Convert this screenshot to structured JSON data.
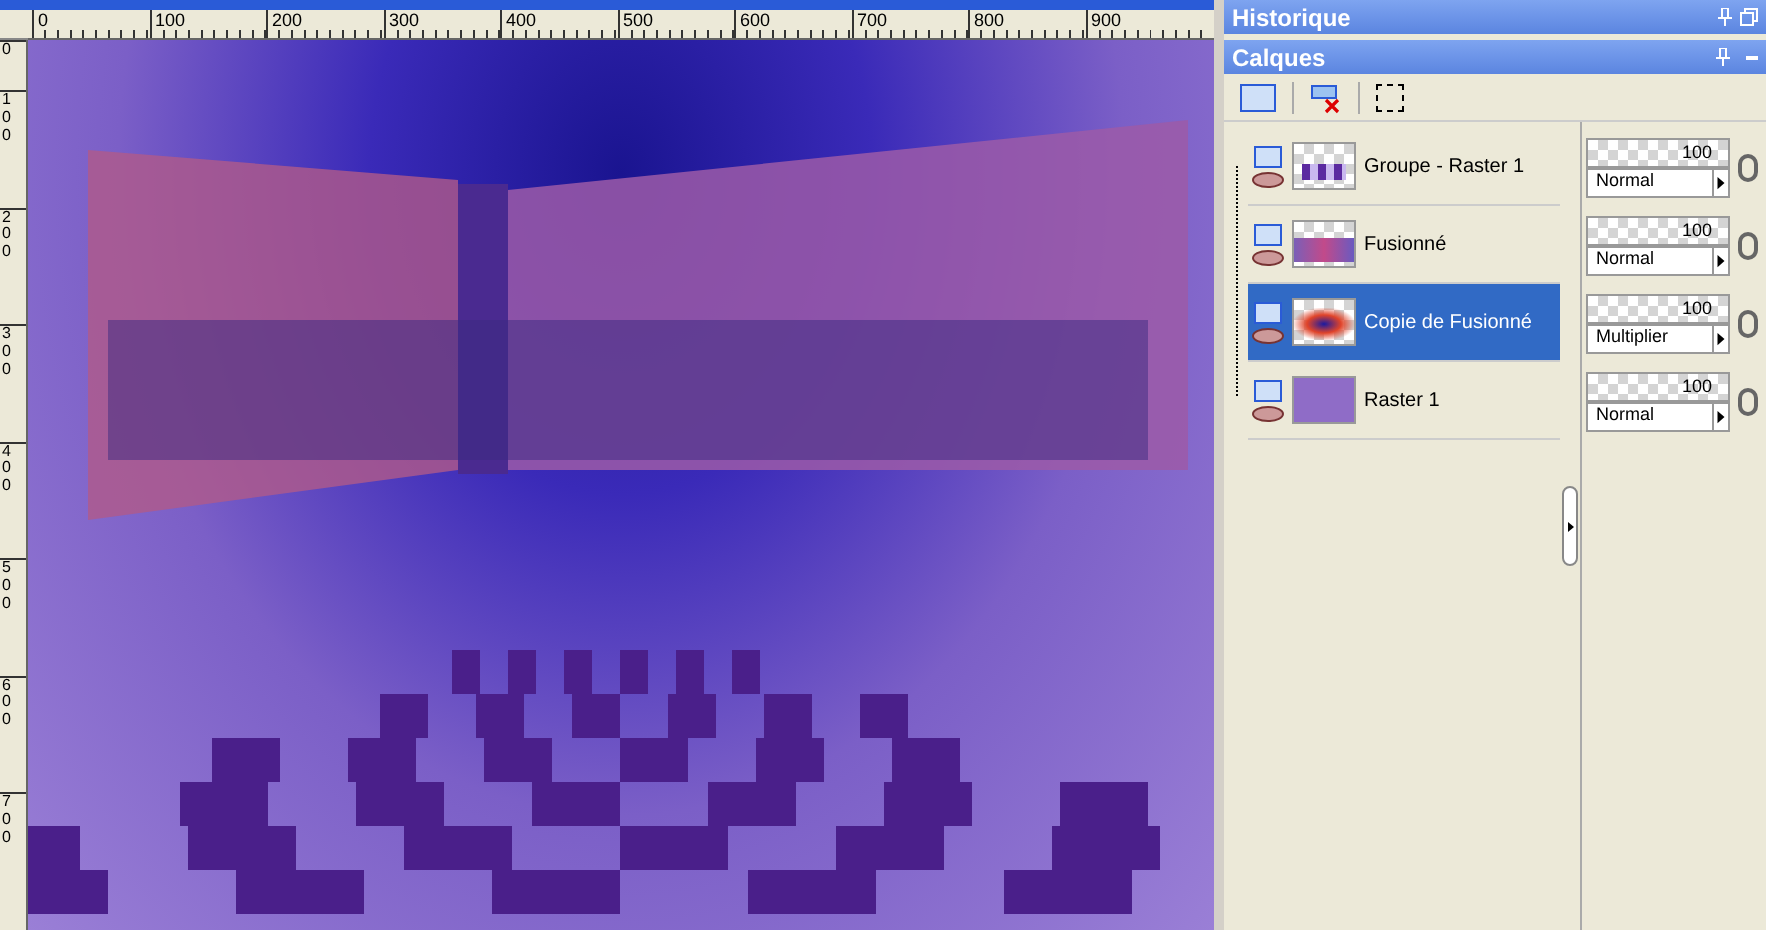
{
  "rulers": {
    "x_labels": [
      "0",
      "100",
      "200",
      "300",
      "400",
      "500",
      "600",
      "700",
      "800",
      "900"
    ],
    "y_labels": [
      "0",
      "100",
      "200",
      "300",
      "400",
      "500",
      "600",
      "700"
    ]
  },
  "historique": {
    "title": "Historique"
  },
  "calques": {
    "title": "Calques",
    "layers": [
      {
        "name": "Groupe - Raster 1",
        "selected": false,
        "kind": "floor",
        "opacity": "100",
        "blend_mode": "Normal"
      },
      {
        "name": "Fusionné",
        "selected": false,
        "kind": "strip",
        "opacity": "100",
        "blend_mode": "Normal"
      },
      {
        "name": "Copie de Fusionné",
        "selected": true,
        "kind": "blur",
        "opacity": "100",
        "blend_mode": "Multiplier"
      },
      {
        "name": "Raster 1",
        "selected": false,
        "kind": "solid",
        "opacity": "100",
        "blend_mode": "Normal"
      }
    ]
  }
}
